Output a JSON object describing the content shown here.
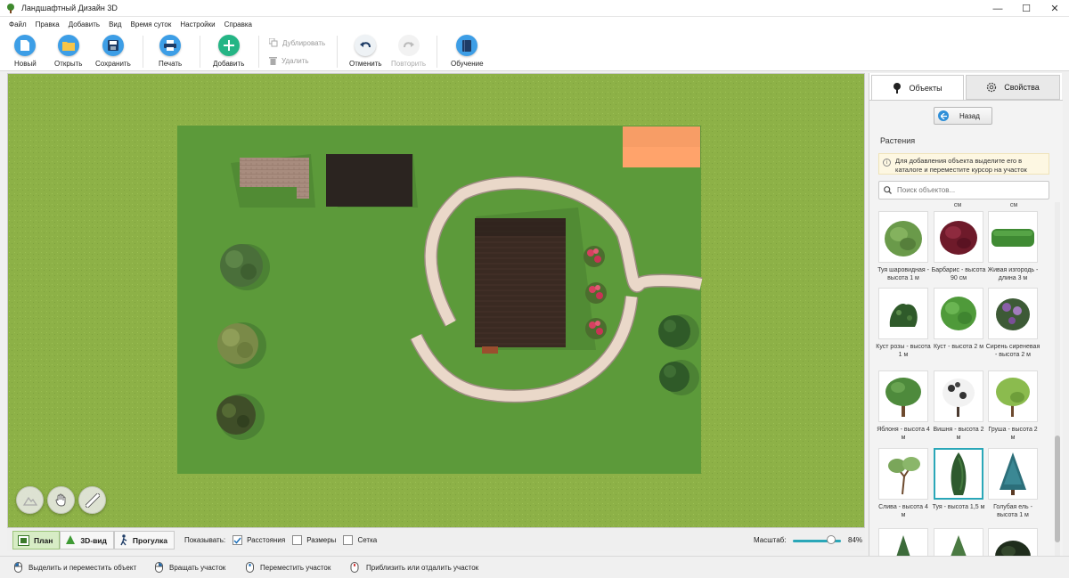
{
  "window": {
    "title": "Ландшафтный Дизайн 3D",
    "controls": [
      "—",
      "☐",
      "✕"
    ]
  },
  "menu": [
    "Файл",
    "Правка",
    "Добавить",
    "Вид",
    "Время суток",
    "Настройки",
    "Справка"
  ],
  "toolbar": {
    "new": "Новый",
    "open": "Открыть",
    "save": "Сохранить",
    "print": "Печать",
    "add": "Добавить",
    "duplicate": "Дублировать",
    "delete": "Удалить",
    "undo": "Отменить",
    "redo": "Повторить",
    "learn": "Обучение"
  },
  "panel": {
    "tab_objects": "Объекты",
    "tab_props": "Свойства",
    "back": "Назад",
    "section_title": "Растения",
    "hint": "Для добавления объекта выделите его в каталоге и переместите курсор на участок",
    "search_placeholder": "Поиск объектов...",
    "top_cut_left": "см",
    "top_cut_right": "см",
    "items": [
      {
        "label": "Туя шаровидная - высота 1 м",
        "icon": "round-shrub"
      },
      {
        "label": "Барбарис - высота 90 см",
        "icon": "barberry"
      },
      {
        "label": "Живая изгородь - длина 3 м",
        "icon": "hedge"
      },
      {
        "label": "Куст розы - высота 1 м",
        "icon": "rose-bush"
      },
      {
        "label": "Куст - высота 2 м",
        "icon": "bush"
      },
      {
        "label": "Сирень сиреневая - высота 2 м",
        "icon": "lilac"
      },
      {
        "label": "Яблоня - высота 4 м",
        "icon": "apple-tree"
      },
      {
        "label": "Вишня - высота 2 м",
        "icon": "cherry-tree"
      },
      {
        "label": "Груша - высота 2 м",
        "icon": "pear-tree"
      },
      {
        "label": "Слива - высота 4 м",
        "icon": "plum-tree"
      },
      {
        "label": "Туя - высота 1,5 м",
        "icon": "thuja",
        "selected": true
      },
      {
        "label": "Голубая ель - высота 1 м",
        "icon": "blue-spruce"
      },
      {
        "label": "",
        "icon": "spruce"
      },
      {
        "label": "",
        "icon": "spruce-2"
      },
      {
        "label": "",
        "icon": "dark-bush"
      }
    ]
  },
  "viewbar": {
    "plan": "План",
    "view3d": "3D-вид",
    "walk": "Прогулка",
    "show_label": "Показывать:",
    "distances": "Расстояния",
    "distances_checked": true,
    "sizes": "Размеры",
    "sizes_checked": false,
    "grid": "Сетка",
    "grid_checked": false,
    "scale_label": "Масштаб:",
    "scale_value": "84%",
    "scale_fraction": 0.84
  },
  "status": {
    "select_move": "Выделить и переместить объект",
    "rotate": "Вращать участок",
    "move": "Переместить участок",
    "zoom": "Приблизить или отдалить участок"
  },
  "colors": {
    "grass_outer": "#8fb24a",
    "grass_plot": "#5c9a3a",
    "path": "#e8d7c8",
    "accent": "#2aa7b8"
  }
}
